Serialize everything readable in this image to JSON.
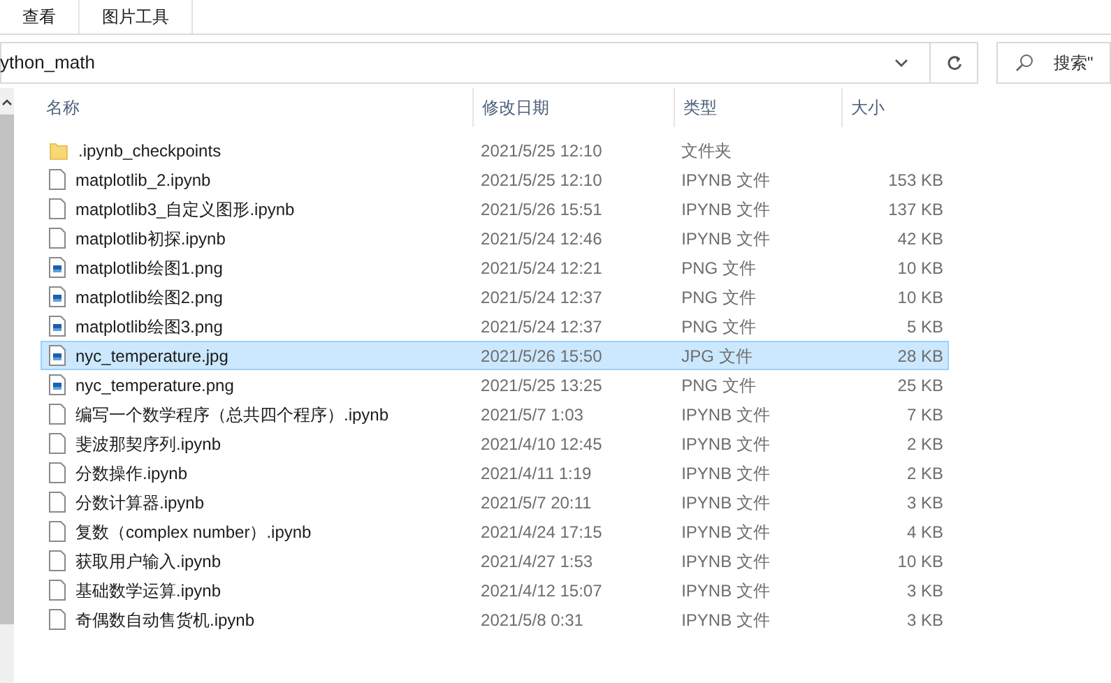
{
  "ribbon_tabs": [
    {
      "label": "查看",
      "selected": false
    },
    {
      "label": "图片工具",
      "selected": false
    }
  ],
  "address_bar": {
    "path": "ython_math"
  },
  "search": {
    "placeholder": "搜索\""
  },
  "table": {
    "columns": [
      "名称",
      "修改日期",
      "类型",
      "大小"
    ],
    "rows": [
      {
        "kind": "folder",
        "name": ".ipynb_checkpoints",
        "date": "2021/5/25 12:10",
        "type": "文件夹",
        "size": "",
        "selected": false
      },
      {
        "kind": "document",
        "name": "matplotlib_2.ipynb",
        "date": "2021/5/25 12:10",
        "type": "IPYNB 文件",
        "size": "153 KB",
        "selected": false
      },
      {
        "kind": "document",
        "name": "matplotlib3_自定义图形.ipynb",
        "date": "2021/5/26 15:51",
        "type": "IPYNB 文件",
        "size": "137 KB",
        "selected": false
      },
      {
        "kind": "document",
        "name": "matplotlib初探.ipynb",
        "date": "2021/5/24 12:46",
        "type": "IPYNB 文件",
        "size": "42 KB",
        "selected": false
      },
      {
        "kind": "image",
        "name": "matplotlib绘图1.png",
        "date": "2021/5/24 12:21",
        "type": "PNG 文件",
        "size": "10 KB",
        "selected": false
      },
      {
        "kind": "image",
        "name": "matplotlib绘图2.png",
        "date": "2021/5/24 12:37",
        "type": "PNG 文件",
        "size": "10 KB",
        "selected": false
      },
      {
        "kind": "image",
        "name": "matplotlib绘图3.png",
        "date": "2021/5/24 12:37",
        "type": "PNG 文件",
        "size": "5 KB",
        "selected": false
      },
      {
        "kind": "image",
        "name": "nyc_temperature.jpg",
        "date": "2021/5/26 15:50",
        "type": "JPG 文件",
        "size": "28 KB",
        "selected": true
      },
      {
        "kind": "image",
        "name": "nyc_temperature.png",
        "date": "2021/5/25 13:25",
        "type": "PNG 文件",
        "size": "25 KB",
        "selected": false
      },
      {
        "kind": "document",
        "name": "编写一个数学程序（总共四个程序）.ipynb",
        "date": "2021/5/7 1:03",
        "type": "IPYNB 文件",
        "size": "7 KB",
        "selected": false
      },
      {
        "kind": "document",
        "name": "斐波那契序列.ipynb",
        "date": "2021/4/10 12:45",
        "type": "IPYNB 文件",
        "size": "2 KB",
        "selected": false
      },
      {
        "kind": "document",
        "name": "分数操作.ipynb",
        "date": "2021/4/11 1:19",
        "type": "IPYNB 文件",
        "size": "2 KB",
        "selected": false
      },
      {
        "kind": "document",
        "name": "分数计算器.ipynb",
        "date": "2021/5/7 20:11",
        "type": "IPYNB 文件",
        "size": "3 KB",
        "selected": false
      },
      {
        "kind": "document",
        "name": "复数（complex number）.ipynb",
        "date": "2021/4/24 17:15",
        "type": "IPYNB 文件",
        "size": "4 KB",
        "selected": false
      },
      {
        "kind": "document",
        "name": "获取用户输入.ipynb",
        "date": "2021/4/27 1:53",
        "type": "IPYNB 文件",
        "size": "10 KB",
        "selected": false
      },
      {
        "kind": "document",
        "name": "基础数学运算.ipynb",
        "date": "2021/4/12 15:07",
        "type": "IPYNB 文件",
        "size": "3 KB",
        "selected": false
      },
      {
        "kind": "document",
        "name": "奇偶数自动售货机.ipynb",
        "date": "2021/5/8 0:31",
        "type": "IPYNB 文件",
        "size": "3 KB",
        "selected": false
      }
    ]
  }
}
